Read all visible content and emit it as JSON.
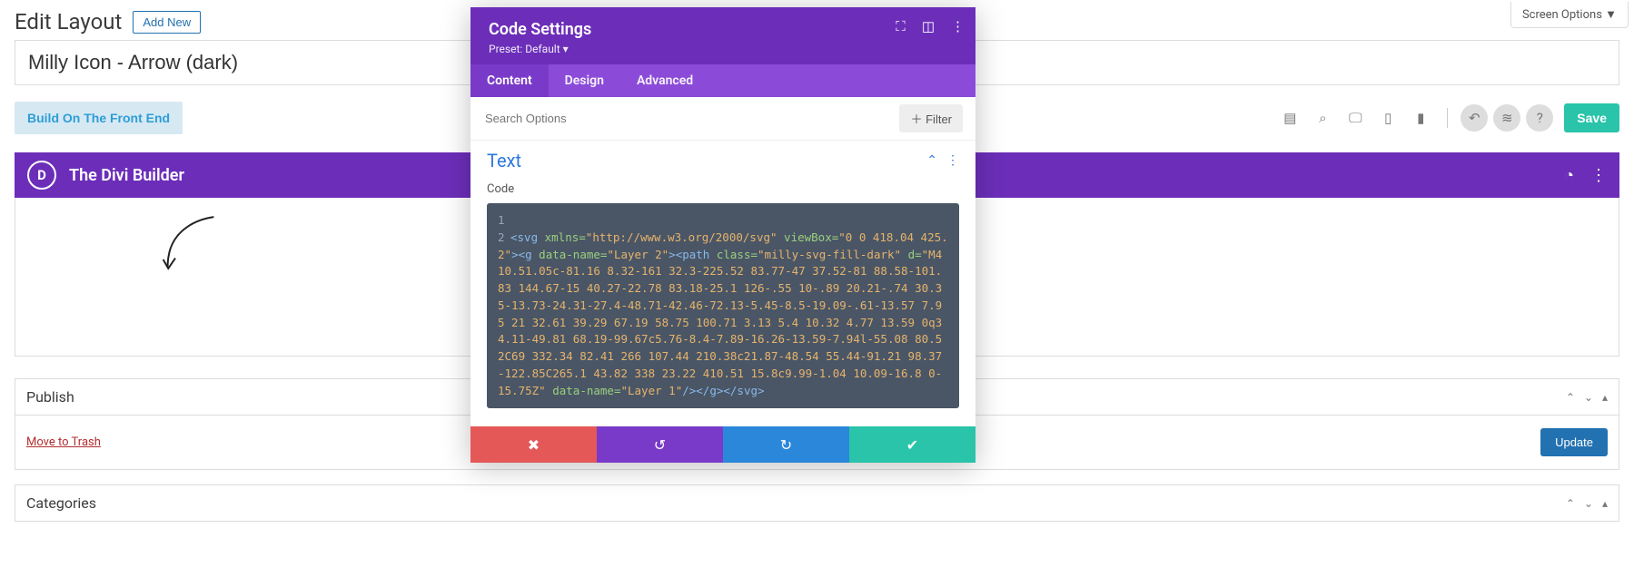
{
  "screen_options_label": "Screen Options ▼",
  "header": {
    "title": "Edit Layout",
    "add_new": "Add New"
  },
  "post_title": "Milly Icon - Arrow (dark)",
  "toolbar": {
    "front_end": "Build On The Front End",
    "save": "Save"
  },
  "divi": {
    "title": "The Divi Builder"
  },
  "publish": {
    "heading": "Publish",
    "trash": "Move to Trash",
    "update": "Update"
  },
  "categories": {
    "heading": "Categories"
  },
  "modal": {
    "title": "Code Settings",
    "preset": "Preset: Default ▾",
    "tabs": {
      "content": "Content",
      "design": "Design",
      "advanced": "Advanced"
    },
    "search_placeholder": "Search Options",
    "filter": "Filter",
    "section_title": "Text",
    "field_label": "Code",
    "code": {
      "line1_num": "1",
      "line2_num": "2",
      "svg_open": "<svg",
      "xmlns_attr": " xmlns=",
      "xmlns_val": "\"http://www.w3.org/2000/svg\"",
      "viewbox_attr": " viewBox=",
      "viewbox_val": "\"0 0 418.04 425.2\"",
      "g_open": "><g",
      "g_dn_attr": " data-name=",
      "g_dn_val": "\"Layer 2\"",
      "path_open": "><path",
      "class_attr": " class=",
      "class_val": "\"milly-svg-fill-dark\"",
      "d_attr": " d=",
      "d_val": "\"M410.51.05c-81.16 8.32-161 32.3-225.52 83.77-47 37.52-81 88.58-101.83 144.67-15 40.27-22.78 83.18-25.1 126-.55 10-.89 20.21-.74 30.35-13.73-24.31-27.4-48.71-42.46-72.13-5.45-8.5-19.09-.61-13.57 7.95 21 32.61 39.29 67.19 58.75 100.71 3.13 5.4 10.32 4.77 13.59 0q34.11-49.81 68.19-99.67c5.76-8.4-7.89-16.26-13.59-7.94l-55.08 80.52C69 332.34 82.41 266 107.44 210.38c21.87-48.54 55.44-91.21 98.37-122.85C265.1 43.82 338 23.22 410.51 15.8c9.99-1.04 10.09-16.8 0-15.75Z\"",
      "path_dn_attr": " data-name=",
      "path_dn_val": "\"Layer 1\"",
      "close": "/></g></svg>"
    }
  }
}
